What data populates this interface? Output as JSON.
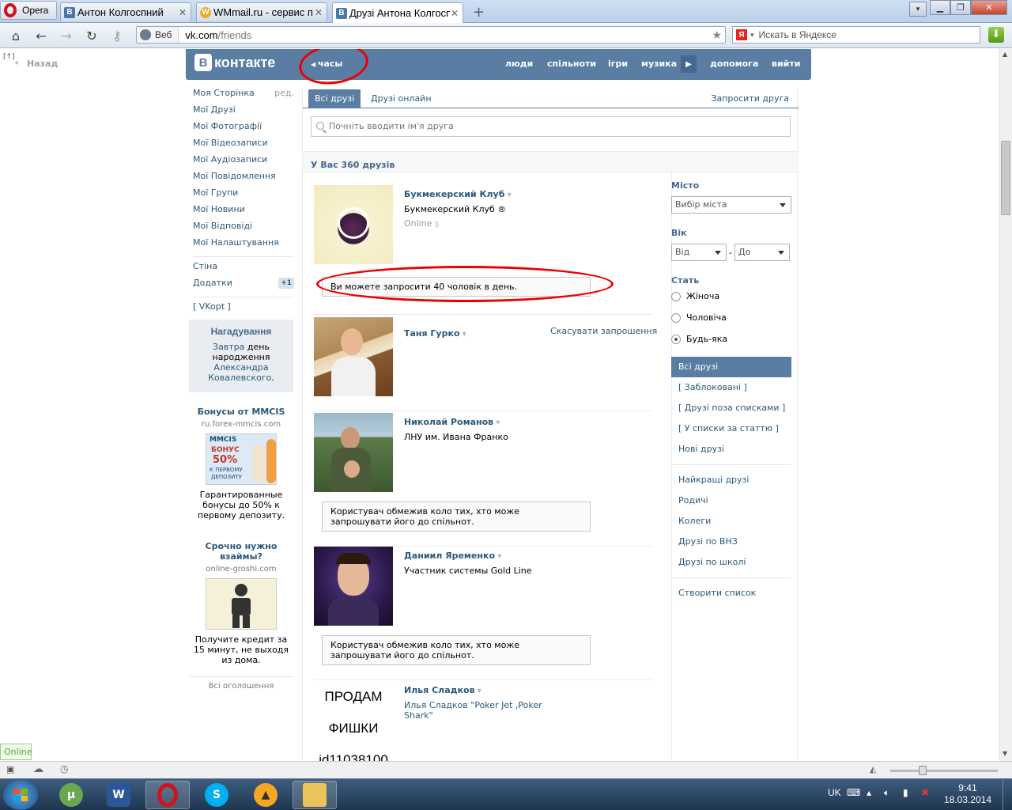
{
  "browser": {
    "menu_label": "Opera",
    "tabs": [
      {
        "title": "Антон Колгоспний",
        "fav": "В"
      },
      {
        "title": "WMmail.ru - сервис п...",
        "fav": "W"
      },
      {
        "title": "Друзі Антона Колгосп...",
        "fav": "В"
      }
    ],
    "address_mode": "Веб",
    "url_host": "vk.com",
    "url_path": "/friends",
    "search_placeholder": "Искать в Яндексе",
    "search_logo": "Я"
  },
  "page": {
    "back_label": "Назад",
    "back_marker": "[↑]",
    "logo_letter": "В",
    "logo_text": "контакте",
    "crumb": "часы",
    "topnav": [
      "люди",
      "спільноти",
      "ігри",
      "музика",
      "допомога",
      "вийти"
    ],
    "left_menu": {
      "primary": [
        "Моя Сторінка",
        "Мої Друзі",
        "Мої Фотографії",
        "Мої Відеозаписи",
        "Мої Аудіозаписи",
        "Мої Повідомлення",
        "Мої Групи",
        "Мої Новини",
        "Мої Відповіді",
        "Мої Налаштування"
      ],
      "edit_label": "ред.",
      "secondary": [
        "Стіна",
        "Додатки"
      ],
      "apps_badge": "+1",
      "vkopt": "[ VKopt ]"
    },
    "reminder": {
      "title": "Нагадування",
      "link1": "Завтра",
      "text1": " день народження ",
      "link2": "Александра Ковалевского",
      "text2": "."
    },
    "ads": [
      {
        "title": "Бонусы от MMCIS",
        "domain": "ru.forex-mmcis.com",
        "img_line1": "MMCIS",
        "img_line2": "БОНУС",
        "img_line3": "50%",
        "img_line4": "К ПЕРВОМУ",
        "img_line5": "ДЕПОЗИТУ",
        "text": "Гарантированные бонусы до 50% к первому депозиту."
      },
      {
        "title": "Срочно нужно взаймы?",
        "domain": "online-groshi.com",
        "text": "Получите кредит за 15 минут, не выходя из дома."
      }
    ],
    "all_ads": "Всі оголошення",
    "tabs": {
      "all": "Всі друзі",
      "online": "Друзі онлайн",
      "invite": "Запросити друга"
    },
    "search_placeholder": "Почніть вводити ім'я друга",
    "friends_count": "У Вас 360 друзів",
    "friends": [
      {
        "name": "Букмекерский Клуб",
        "desc": "Букмекерский Клуб ®",
        "status": "Online",
        "notice": "Ви можете запросити 40 чоловік в день."
      },
      {
        "name": "Таня Гурко",
        "action": "Скасувати запрошення"
      },
      {
        "name": "Николай Романов",
        "desc": "ЛНУ им. Ивана Франко",
        "notice": "Користувач обмежив коло тих, хто може запрошувати його до спільнот."
      },
      {
        "name": "Даниил Яременко",
        "desc": "Участник системы Gold Line",
        "notice": "Користувач обмежив коло тих, хто може запрошувати його до спільнот."
      },
      {
        "name": "Илья Сладков",
        "desc": "Илья Сладков \"Poker Jet ,Poker Shark\"",
        "photo_lines": [
          "ПРОДАМ",
          "ФИШКИ",
          "id11038100"
        ]
      }
    ],
    "filter": {
      "city_label": "Місто",
      "city_select": "Вибір міста",
      "age_label": "Вік",
      "age_from": "Від",
      "age_dash": "-",
      "age_to": "До",
      "sex_label": "Стать",
      "sex_options": [
        "Жіноча",
        "Чоловіча",
        "Будь-яка"
      ],
      "sex_selected": 2
    },
    "lists_a": [
      "Всі друзі",
      "[ Заблоковані ]",
      "[ Друзі поза списками ]",
      "[ У списки за статтю ]",
      "Нові друзі"
    ],
    "lists_b": [
      "Найкращі друзі",
      "Родичі",
      "Колеги",
      "Друзі по ВНЗ",
      "Друзі по школі"
    ],
    "lists_c": [
      "Створити список"
    ],
    "online_badge": "Online"
  },
  "taskbar": {
    "lang": "UK",
    "time": "9:41",
    "date": "18.03.2014"
  },
  "colors": {
    "vk_blue": "#597da3",
    "link": "#2b587a",
    "annotation": "#e00000"
  }
}
